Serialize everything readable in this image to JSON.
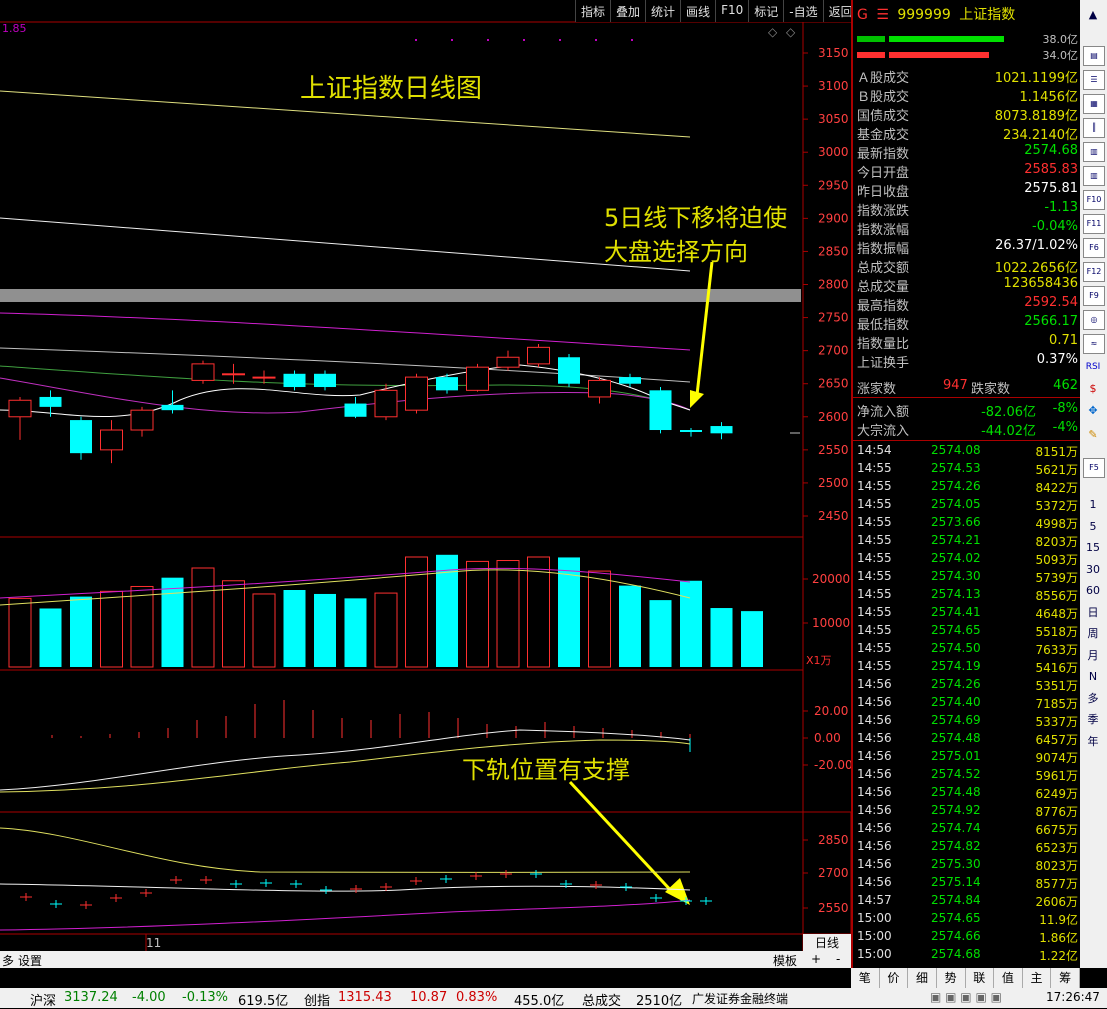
{
  "toolbar": [
    "指标",
    "叠加",
    "统计",
    "画线",
    "F10",
    "标记",
    "-自选",
    "返回"
  ],
  "chart": {
    "corner_value": "1.85",
    "annotation_top": "上证指数日线图",
    "annotation_mid_1": "5日线下移将迫使",
    "annotation_mid_2": "大盘选择方向",
    "annotation_bottom": "下轨位置有支撑",
    "price_axis": [
      "3150",
      "3100",
      "3050",
      "3000",
      "2950",
      "2900",
      "2850",
      "2800",
      "2750",
      "2700",
      "2650",
      "2600",
      "2550",
      "2500",
      "2450"
    ],
    "vol_axis": [
      "20000",
      "10000"
    ],
    "vol_unit": "X1万",
    "macd_axis": [
      "20.00",
      "0.00",
      "-20.00"
    ],
    "boll_axis": [
      "2850",
      "2700",
      "2550"
    ],
    "date_marker": "11",
    "period_label": "日线",
    "bottom_left_1": "多",
    "bottom_left_2": "设置",
    "bottom_right_1": "模板",
    "bottom_right_2": "+",
    "bottom_right_3": "-"
  },
  "chart_data": {
    "type": "candlestick",
    "ylim": [
      2420,
      3180
    ],
    "candles": [
      {
        "o": 2600,
        "c": 2625,
        "h": 2630,
        "l": 2565,
        "up": true
      },
      {
        "o": 2615,
        "c": 2630,
        "h": 2640,
        "l": 2600,
        "up": false
      },
      {
        "o": 2595,
        "c": 2545,
        "h": 2600,
        "l": 2535,
        "up": false
      },
      {
        "o": 2550,
        "c": 2580,
        "h": 2595,
        "l": 2530,
        "up": true
      },
      {
        "o": 2580,
        "c": 2610,
        "h": 2615,
        "l": 2570,
        "up": true
      },
      {
        "o": 2610,
        "c": 2618,
        "h": 2640,
        "l": 2605,
        "up": false
      },
      {
        "o": 2655,
        "c": 2680,
        "h": 2685,
        "l": 2650,
        "up": true
      },
      {
        "o": 2665,
        "c": 2665,
        "h": 2680,
        "l": 2650,
        "up": true
      },
      {
        "o": 2660,
        "c": 2660,
        "h": 2670,
        "l": 2650,
        "up": true
      },
      {
        "o": 2665,
        "c": 2645,
        "h": 2670,
        "l": 2640,
        "up": false
      },
      {
        "o": 2665,
        "c": 2645,
        "h": 2670,
        "l": 2640,
        "up": false
      },
      {
        "o": 2620,
        "c": 2600,
        "h": 2630,
        "l": 2598,
        "up": false
      },
      {
        "o": 2600,
        "c": 2640,
        "h": 2650,
        "l": 2595,
        "up": true
      },
      {
        "o": 2610,
        "c": 2660,
        "h": 2665,
        "l": 2605,
        "up": true
      },
      {
        "o": 2660,
        "c": 2640,
        "h": 2665,
        "l": 2635,
        "up": false
      },
      {
        "o": 2640,
        "c": 2675,
        "h": 2680,
        "l": 2638,
        "up": true
      },
      {
        "o": 2675,
        "c": 2690,
        "h": 2700,
        "l": 2670,
        "up": true
      },
      {
        "o": 2680,
        "c": 2705,
        "h": 2710,
        "l": 2675,
        "up": true
      },
      {
        "o": 2690,
        "c": 2650,
        "h": 2695,
        "l": 2645,
        "up": false
      },
      {
        "o": 2630,
        "c": 2655,
        "h": 2660,
        "l": 2620,
        "up": true
      },
      {
        "o": 2660,
        "c": 2650,
        "h": 2665,
        "l": 2645,
        "up": false
      },
      {
        "o": 2640,
        "c": 2580,
        "h": 2645,
        "l": 2575,
        "up": false
      },
      {
        "o": 2580,
        "c": 2577,
        "h": 2583,
        "l": 2570,
        "up": false
      },
      {
        "o": 2586,
        "c": 2575,
        "h": 2592,
        "l": 2566,
        "up": false
      }
    ],
    "volumes": [
      15600,
      13300,
      16000,
      17200,
      18300,
      20300,
      22500,
      19600,
      16600,
      17500,
      16600,
      15600,
      16800,
      25000,
      25500,
      24000,
      24200,
      25000,
      24900,
      21800,
      18500,
      15200,
      19600,
      13400,
      12700
    ]
  },
  "quote": {
    "code": "999999",
    "name": "上证指数",
    "bar1_val": "38.0亿",
    "bar2_val": "34.0亿",
    "rows": [
      {
        "label": "Ａ股成交",
        "value": "1021.1199亿",
        "color": "#e0e000"
      },
      {
        "label": "Ｂ股成交",
        "value": "1.1456亿",
        "color": "#e0e000"
      },
      {
        "label": "国债成交",
        "value": "8073.8189亿",
        "color": "#e0e000"
      },
      {
        "label": "基金成交",
        "value": "234.2140亿",
        "color": "#e0e000"
      },
      {
        "label": "最新指数",
        "value": "2574.68",
        "color": "#00e000"
      },
      {
        "label": "今日开盘",
        "value": "2585.83",
        "color": "#ff3030"
      },
      {
        "label": "昨日收盘",
        "value": "2575.81",
        "color": "#ffffff"
      },
      {
        "label": "指数涨跌",
        "value": "-1.13",
        "color": "#00e000"
      },
      {
        "label": "指数涨幅",
        "value": "-0.04%",
        "color": "#00e000"
      },
      {
        "label": "指数振幅",
        "value": "26.37/1.02%",
        "color": "#ffffff"
      },
      {
        "label": "总成交额",
        "value": "1022.2656亿",
        "color": "#e0e000"
      },
      {
        "label": "总成交量",
        "value": "123658436",
        "color": "#e0e000"
      },
      {
        "label": "最高指数",
        "value": "2592.54",
        "color": "#ff3030"
      },
      {
        "label": "最低指数",
        "value": "2566.17",
        "color": "#00e000"
      },
      {
        "label": "指数量比",
        "value": "0.71",
        "color": "#e0e000"
      },
      {
        "label": "上证换手",
        "value": "0.37%",
        "color": "#ffffff"
      }
    ],
    "up_label": "涨家数",
    "up_count": "947",
    "down_label": "跌家数",
    "down_count": "462",
    "netflow_label": "净流入额",
    "netflow_value": "-82.06亿",
    "netflow_pct": "-8%",
    "bulk_label": "大宗流入",
    "bulk_value": "-44.02亿",
    "bulk_pct": "-4%"
  },
  "ticks": [
    {
      "t": "14:54",
      "p": "2574.08",
      "v": "8151万"
    },
    {
      "t": "14:55",
      "p": "2574.53",
      "v": "5621万"
    },
    {
      "t": "14:55",
      "p": "2574.26",
      "v": "8422万"
    },
    {
      "t": "14:55",
      "p": "2574.05",
      "v": "5372万"
    },
    {
      "t": "14:55",
      "p": "2573.66",
      "v": "4998万"
    },
    {
      "t": "14:55",
      "p": "2574.21",
      "v": "8203万"
    },
    {
      "t": "14:55",
      "p": "2574.02",
      "v": "5093万"
    },
    {
      "t": "14:55",
      "p": "2574.30",
      "v": "5739万"
    },
    {
      "t": "14:55",
      "p": "2574.13",
      "v": "8556万"
    },
    {
      "t": "14:55",
      "p": "2574.41",
      "v": "4648万"
    },
    {
      "t": "14:55",
      "p": "2574.65",
      "v": "5518万"
    },
    {
      "t": "14:55",
      "p": "2574.50",
      "v": "7633万"
    },
    {
      "t": "14:55",
      "p": "2574.19",
      "v": "5416万"
    },
    {
      "t": "14:56",
      "p": "2574.26",
      "v": "5351万"
    },
    {
      "t": "14:56",
      "p": "2574.40",
      "v": "7185万"
    },
    {
      "t": "14:56",
      "p": "2574.69",
      "v": "5337万"
    },
    {
      "t": "14:56",
      "p": "2574.48",
      "v": "6457万"
    },
    {
      "t": "14:56",
      "p": "2575.01",
      "v": "9074万"
    },
    {
      "t": "14:56",
      "p": "2574.52",
      "v": "5961万"
    },
    {
      "t": "14:56",
      "p": "2574.48",
      "v": "6249万"
    },
    {
      "t": "14:56",
      "p": "2574.92",
      "v": "8776万"
    },
    {
      "t": "14:56",
      "p": "2574.74",
      "v": "6675万"
    },
    {
      "t": "14:56",
      "p": "2574.82",
      "v": "6523万"
    },
    {
      "t": "14:56",
      "p": "2575.30",
      "v": "8023万"
    },
    {
      "t": "14:56",
      "p": "2575.14",
      "v": "8577万"
    },
    {
      "t": "14:57",
      "p": "2574.84",
      "v": "2606万"
    },
    {
      "t": "15:00",
      "p": "2574.65",
      "v": "11.9亿"
    },
    {
      "t": "15:00",
      "p": "2574.66",
      "v": "1.86亿"
    },
    {
      "t": "15:00",
      "p": "2574.68",
      "v": "1.22亿"
    }
  ],
  "side_icons": [
    "1",
    "5",
    "15",
    "30",
    "60",
    "日",
    "周",
    "月",
    "N",
    "多",
    "季",
    "年"
  ],
  "bottom_tabs": [
    "笔",
    "价",
    "细",
    "势",
    "联",
    "值",
    "主",
    "筹"
  ],
  "status": {
    "hs_label": "沪深",
    "hs_val": "3137.24",
    "hs_chg": "-4.00",
    "hs_pct": "-0.13%",
    "hs_amt": "619.5亿",
    "cy_label": "创指",
    "cy_val": "1315.43",
    "cy_chg": "10.87",
    "cy_pct": "0.83%",
    "cy_amt": "455.0亿",
    "total_label": "总成交",
    "total_val": "2510亿",
    "broker": "广发证券金融终端",
    "time": "17:26:47"
  }
}
